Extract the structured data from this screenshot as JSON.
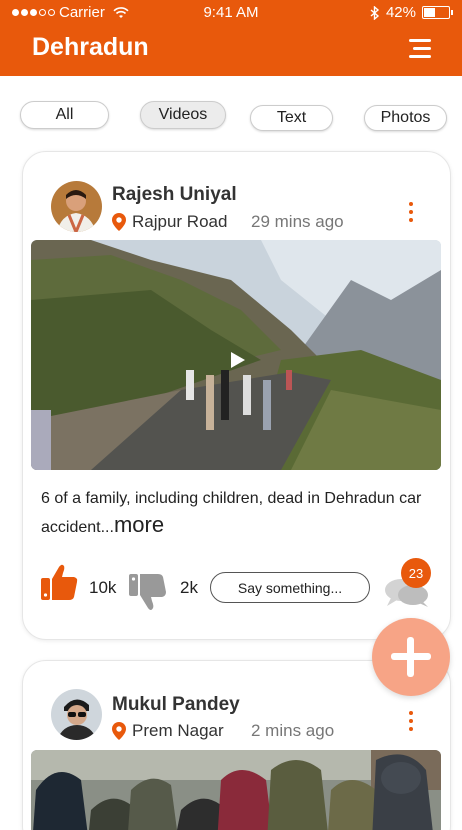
{
  "status_bar": {
    "carrier": "Carrier",
    "time": "9:41 AM",
    "battery": "42%",
    "battery_level": 0.42
  },
  "header": {
    "title": "Dehradun",
    "menu_icon": "hamburger-menu-icon"
  },
  "filters": {
    "tabs": [
      {
        "label": "All",
        "active": false
      },
      {
        "label": "Videos",
        "active": true
      },
      {
        "label": "Text",
        "active": false
      },
      {
        "label": "Photos",
        "active": false
      }
    ]
  },
  "posts": [
    {
      "author": "Rajesh Uniyal",
      "location": "Rajpur Road",
      "time": "29 mins ago",
      "media_type": "video",
      "caption": "6 of a family, including children, dead in Dehradun car accident...",
      "more_label": "more",
      "likes": "10k",
      "dislikes": "2k",
      "comment_placeholder": "Say something...",
      "comment_count": "23"
    },
    {
      "author": "Mukul Pandey",
      "location": "Prem Nagar",
      "time": "2 mins ago",
      "media_type": "photo"
    }
  ],
  "colors": {
    "accent": "#e8590c",
    "fab": "#f7a486"
  }
}
